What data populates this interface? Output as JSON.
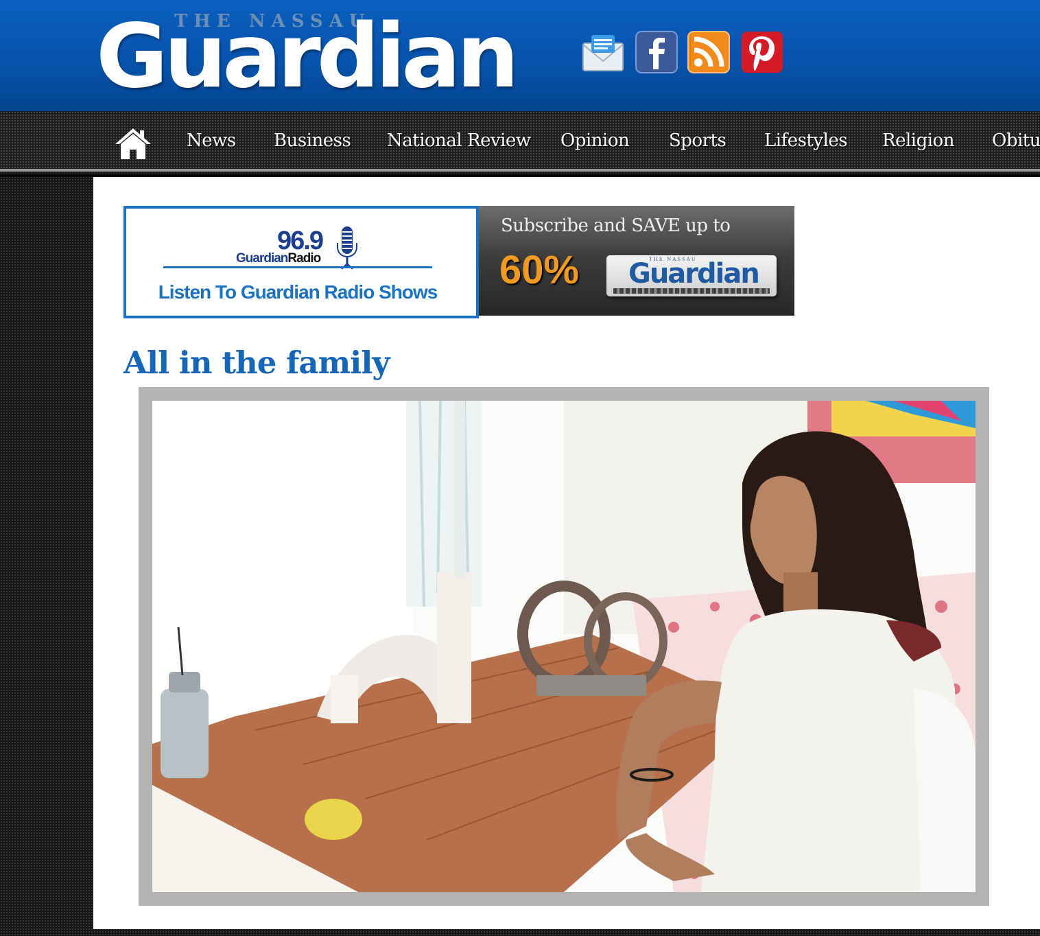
{
  "site": {
    "masthead_top": "THE NASSAU",
    "masthead_name": "Guardian"
  },
  "social": [
    {
      "icon": "email-icon"
    },
    {
      "icon": "facebook-icon"
    },
    {
      "icon": "rss-icon"
    },
    {
      "icon": "pinterest-icon"
    }
  ],
  "nav": {
    "items": [
      "News",
      "Business",
      "National Review",
      "Opinion",
      "Sports",
      "Lifestyles",
      "Religion",
      "Obitua"
    ]
  },
  "ads": {
    "radio": {
      "frequency": "96.9",
      "brand_a": "Guardian",
      "brand_b": "Radio",
      "cta": "Listen To Guardian Radio Shows"
    },
    "subscribe": {
      "text": "Subscribe and SAVE up to",
      "percent": "60%",
      "paper_top": "THE NASSAU",
      "paper_name": "Guardian"
    }
  },
  "article": {
    "headline": "All in the family"
  },
  "colors": {
    "header_blue": "#0753ad",
    "headline_blue": "#1666b8",
    "accent_orange": "#f29a1f"
  }
}
